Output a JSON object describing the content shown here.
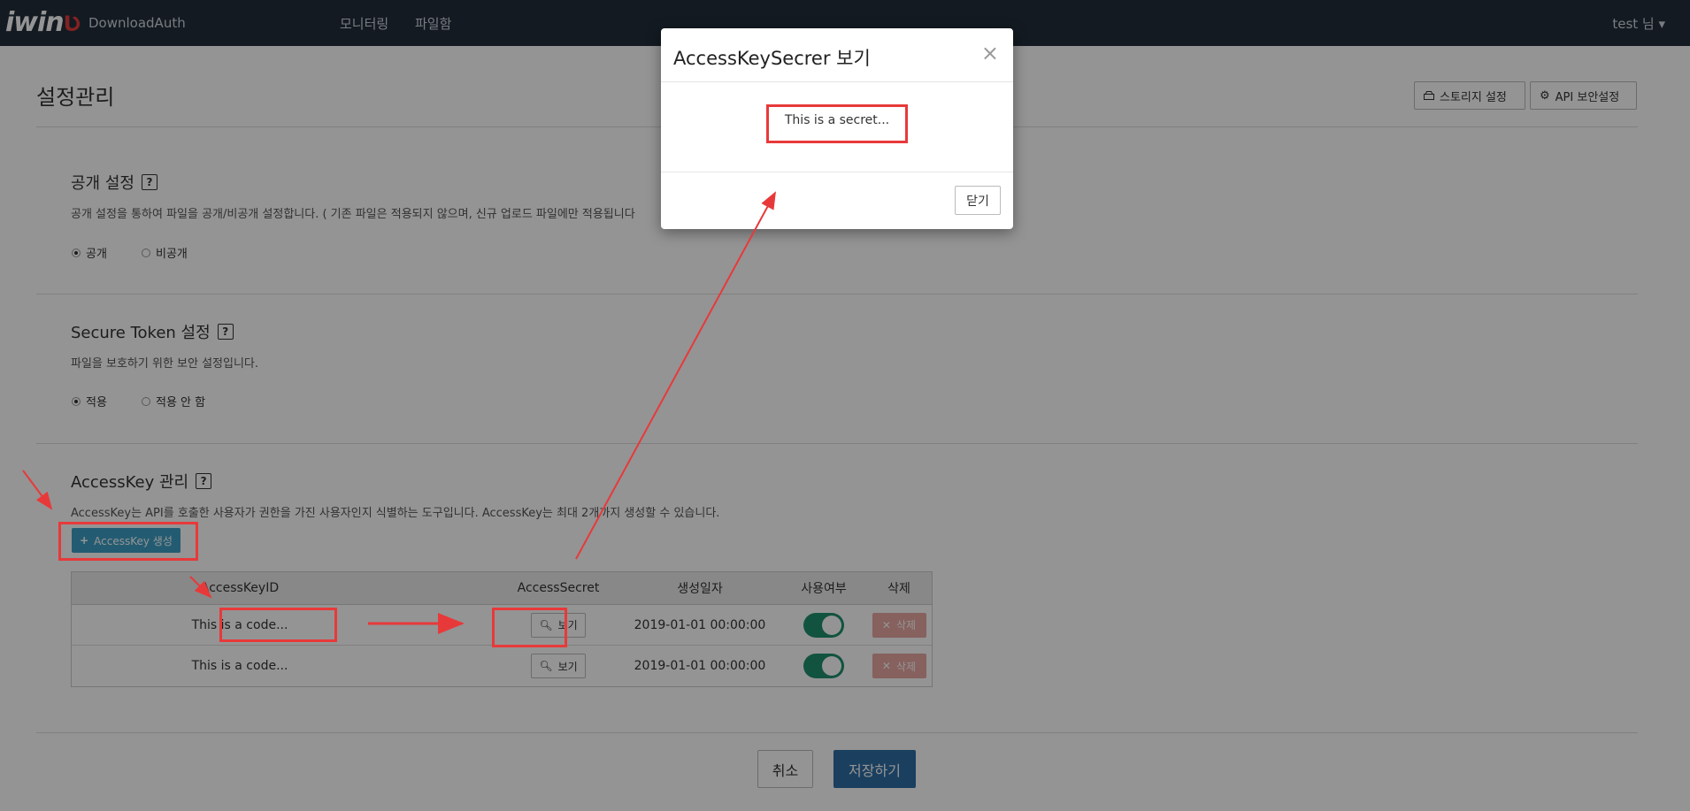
{
  "navbar": {
    "logo_text": "iwin",
    "logo_accent": "Ʋ",
    "app_name": "DownloadAuth",
    "links": [
      "모니터링",
      "파일함"
    ],
    "user": "test 님 ▾"
  },
  "page": {
    "title": "설정관리",
    "storage_button": "스토리지 설정",
    "api_security_button": "API 보안설정"
  },
  "public_setting": {
    "title": "공개 설정",
    "help": "?",
    "description": "공개 설정을 통하여 파일을 공개/비공개 설정합니다. ( 기존 파일은 적용되지 않으며, 신규 업로드 파일에만 적용됩니다",
    "options": [
      "공개",
      "비공개"
    ],
    "selected": "공개"
  },
  "secure_token": {
    "title": "Secure Token 설정",
    "help": "?",
    "description": "파일을 보호하기 위한 보안 설정입니다.",
    "options": [
      "적용",
      "적용 안 함"
    ],
    "selected": "적용"
  },
  "access_key": {
    "title": "AccessKey 관리",
    "help": "?",
    "description": "AccessKey는 API를 호출한 사용자가 권한을 가진 사용자인지 식별하는 도구입니다. AccessKey는 최대 2개까지 생성할 수 있습니다.",
    "create_button": "AccessKey 생성",
    "columns": [
      "AccessKeyID",
      "AccessSecret",
      "생성일자",
      "사용여부",
      "삭제"
    ],
    "rows": [
      {
        "id": "This is a code...",
        "view": "보기",
        "created": "2019-01-01 00:00:00",
        "enabled": true,
        "delete": "삭제"
      },
      {
        "id": "This is a code...",
        "view": "보기",
        "created": "2019-01-01 00:00:00",
        "enabled": true,
        "delete": "삭제"
      }
    ]
  },
  "footer": {
    "cancel": "취소",
    "save": "저장하기"
  },
  "modal": {
    "title": "AccessKeySecrer 보기",
    "close_symbol": "×",
    "secret": "This is a secret...",
    "close_button": "닫기"
  },
  "colors": {
    "navbar": "#222d3a",
    "primary": "#2e6da4",
    "info": "#3d9fc4",
    "danger": "#e7a7a3",
    "toggle_on": "#1f8f6e",
    "annotation": "#e8393a"
  }
}
